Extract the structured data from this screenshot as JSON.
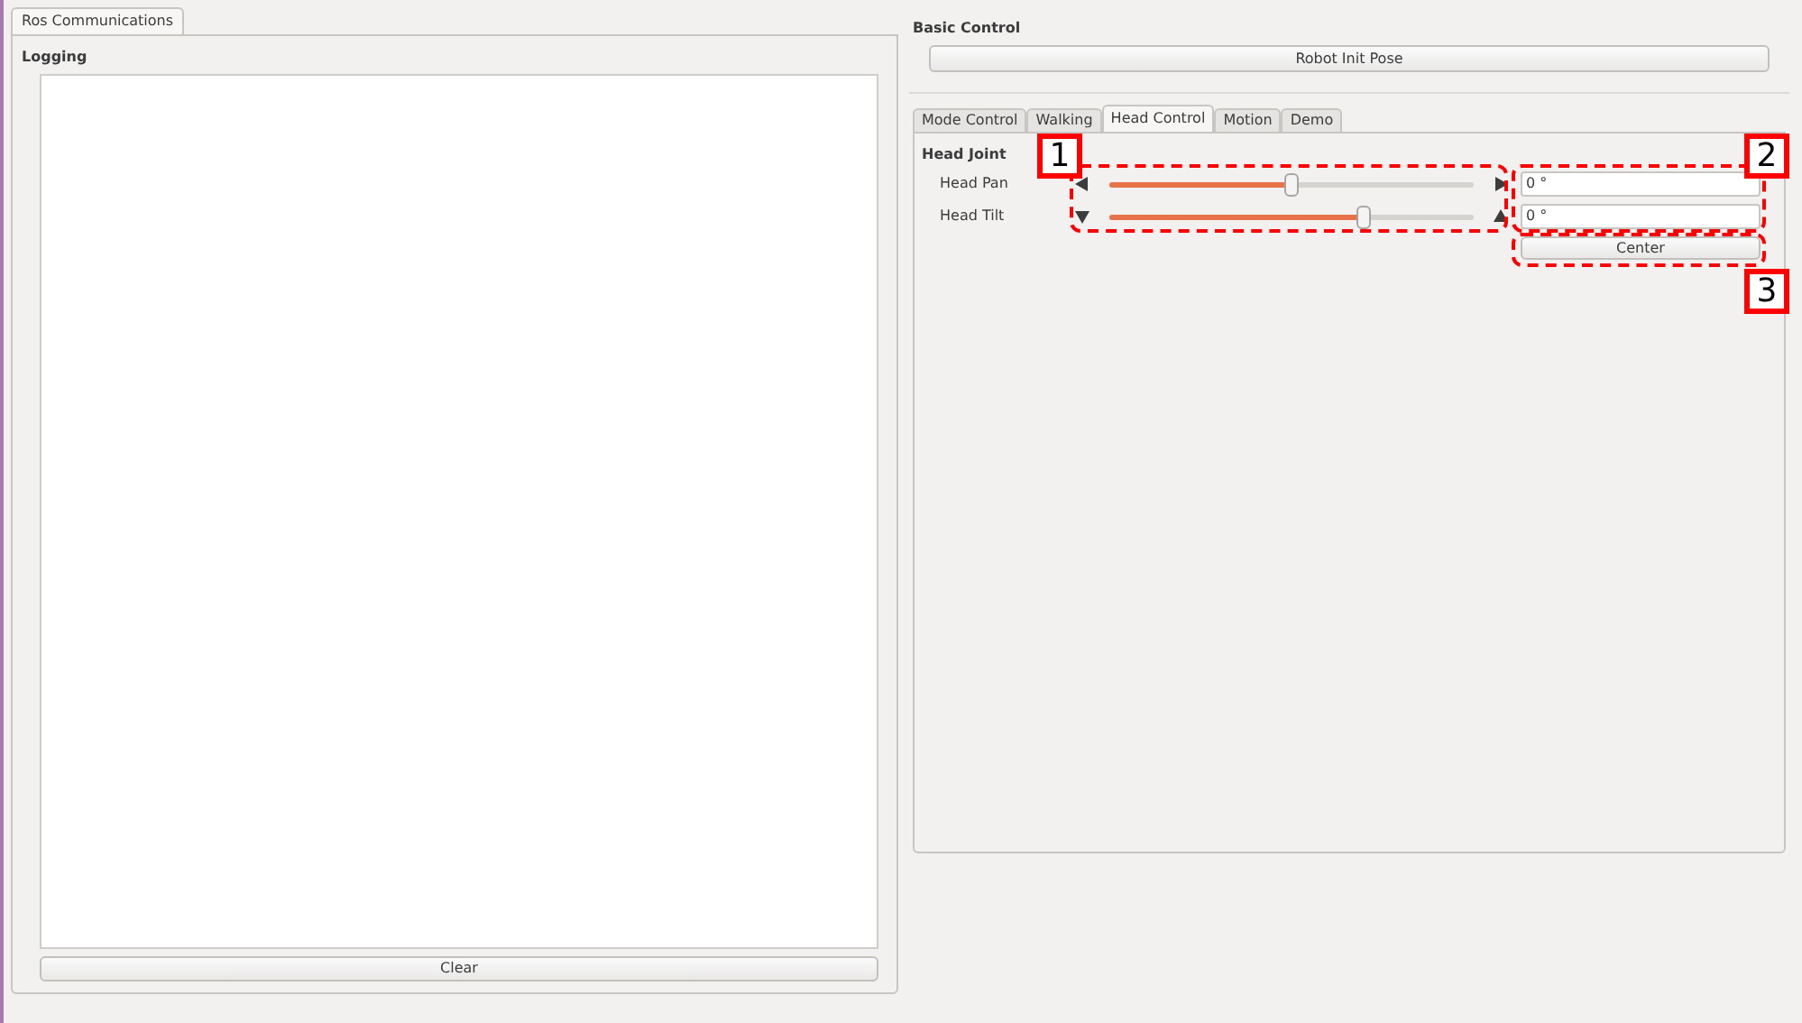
{
  "left_panel": {
    "tabs": [
      {
        "label": "Ros Communications",
        "selected": true
      }
    ],
    "logging": {
      "title": "Logging"
    },
    "clear_button": "Clear"
  },
  "right_panel": {
    "basic_control": {
      "title": "Basic Control",
      "button": "Robot Init Pose"
    },
    "tabs": [
      {
        "label": "Mode Control",
        "selected": false
      },
      {
        "label": "Walking",
        "selected": false
      },
      {
        "label": "Head Control",
        "selected": true
      },
      {
        "label": "Motion",
        "selected": false
      },
      {
        "label": "Demo",
        "selected": false
      }
    ],
    "head_joint": {
      "title": "Head Joint",
      "joints": [
        {
          "label": "Head Pan",
          "kind": "horizontal",
          "level": 0.5,
          "value": "0 °"
        },
        {
          "label": "Head Tilt",
          "kind": "vertical",
          "level": 0.7,
          "value": "0 °"
        }
      ],
      "center_button": "Center"
    },
    "annotations": [
      "1",
      "2",
      "3"
    ]
  }
}
